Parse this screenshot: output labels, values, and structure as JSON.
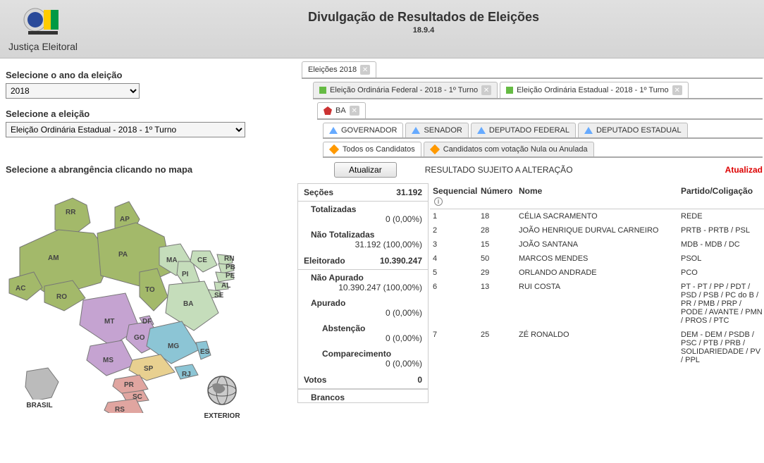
{
  "header": {
    "org": "Justiça Eleitoral",
    "title": "Divulgação de Resultados de Eleições",
    "version": "18.9.4"
  },
  "left": {
    "year_label": "Selecione o ano da eleição",
    "year_value": "2018",
    "election_label": "Selecione a eleição",
    "election_value": "Eleição Ordinária Estadual - 2018 - 1º Turno",
    "scope_label": "Selecione a abrangência clicando no mapa",
    "brasil": "BRASIL",
    "exterior": "EXTERIOR",
    "states": [
      "RR",
      "AP",
      "AM",
      "PA",
      "MA",
      "CE",
      "RN",
      "PB",
      "PE",
      "AL",
      "SE",
      "PI",
      "AC",
      "RO",
      "TO",
      "BA",
      "MT",
      "DF",
      "GO",
      "MG",
      "ES",
      "MS",
      "SP",
      "RJ",
      "PR",
      "SC",
      "RS"
    ]
  },
  "right": {
    "tab_main": "Eleições 2018",
    "tab_federal": "Eleição Ordinária Federal - 2018 - 1º Turno",
    "tab_estadual": "Eleição Ordinária Estadual - 2018 - 1º Turno",
    "state_tab": "BA",
    "role_tabs": [
      "GOVERNADOR",
      "SENADOR",
      "DEPUTADO FEDERAL",
      "DEPUTADO ESTADUAL"
    ],
    "filter_all": "Todos os Candidatos",
    "filter_null": "Candidatos com votação Nula ou Anulada",
    "atualizar": "Atualizar",
    "status": "RESULTADO SUJEITO A ALTERAÇÃO",
    "alert": "Atualizad",
    "stats": {
      "secoes_label": "Seções",
      "secoes_value": "31.192",
      "totalizadas_label": "Totalizadas",
      "totalizadas_value": "0 (0,00%)",
      "nao_totalizadas_label": "Não Totalizadas",
      "nao_totalizadas_value": "31.192 (100,00%)",
      "eleitorado_label": "Eleitorado",
      "eleitorado_value": "10.390.247",
      "nao_apurado_label": "Não Apurado",
      "nao_apurado_value": "10.390.247 (100,00%)",
      "apurado_label": "Apurado",
      "apurado_value": "0 (0,00%)",
      "abstencao_label": "Abstenção",
      "abstencao_value": "0 (0,00%)",
      "comparecimento_label": "Comparecimento",
      "comparecimento_value": "0 (0,00%)",
      "votos_label": "Votos",
      "votos_value": "0",
      "brancos_label": "Brancos"
    },
    "cols": {
      "seq": "Sequencial",
      "num": "Número",
      "nome": "Nome",
      "part": "Partido/Coligação"
    },
    "rows": [
      {
        "seq": "1",
        "num": "18",
        "nome": "CÉLIA SACRAMENTO",
        "part": "REDE"
      },
      {
        "seq": "2",
        "num": "28",
        "nome": "JOÃO HENRIQUE DURVAL CARNEIRO",
        "part": "PRTB - PRTB / PSL"
      },
      {
        "seq": "3",
        "num": "15",
        "nome": "JOÃO SANTANA",
        "part": "MDB - MDB / DC"
      },
      {
        "seq": "4",
        "num": "50",
        "nome": "MARCOS MENDES",
        "part": "PSOL"
      },
      {
        "seq": "5",
        "num": "29",
        "nome": "ORLANDO ANDRADE",
        "part": "PCO"
      },
      {
        "seq": "6",
        "num": "13",
        "nome": "RUI COSTA",
        "part": "PT - PT / PP / PDT / PSD / PSB / PC do B / PR / PMB / PRP / PODE / AVANTE / PMN / PROS / PTC"
      },
      {
        "seq": "7",
        "num": "25",
        "nome": "ZÉ RONALDO",
        "part": "DEM - DEM / PSDB / PSC / PTB / PRB / SOLIDARIEDADE / PV / PPL"
      }
    ]
  }
}
